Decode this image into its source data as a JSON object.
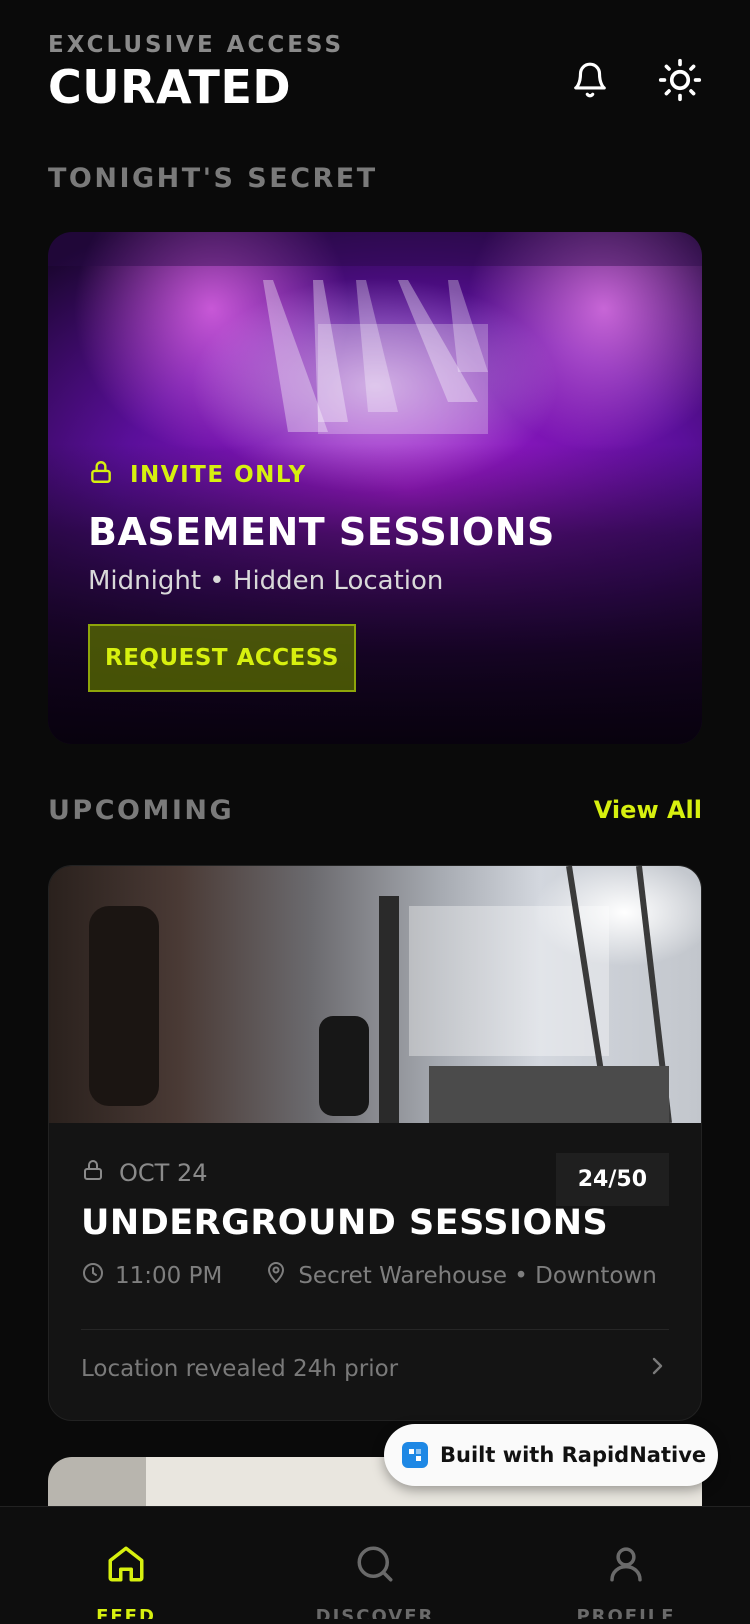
{
  "header": {
    "eyebrow": "EXCLUSIVE ACCESS",
    "title": "CURATED",
    "icons": [
      "bell-icon",
      "sun-icon"
    ]
  },
  "sections": {
    "tonight_label": "TONIGHT'S SECRET",
    "upcoming_label": "UPCOMING",
    "view_all": "View All"
  },
  "featured": {
    "badge": "INVITE ONLY",
    "title": "BASEMENT SESSIONS",
    "subtitle": "Midnight • Hidden Location",
    "cta": "REQUEST ACCESS"
  },
  "upcoming": [
    {
      "date": "OCT 24",
      "capacity": "24/50",
      "title": "UNDERGROUND SESSIONS",
      "time": "11:00 PM",
      "location": "Secret Warehouse • Downtown",
      "footer": "Location revealed 24h prior"
    }
  ],
  "badge": {
    "text": "Built with RapidNative"
  },
  "tabs": [
    {
      "label": "FEED",
      "icon": "home-icon",
      "active": true
    },
    {
      "label": "DISCOVER",
      "icon": "search-icon",
      "active": false
    },
    {
      "label": "PROFILE",
      "icon": "user-icon",
      "active": false
    }
  ],
  "colors": {
    "accent": "#d7f00f",
    "background": "#0a0a0a",
    "muted": "#7a7a7a"
  }
}
